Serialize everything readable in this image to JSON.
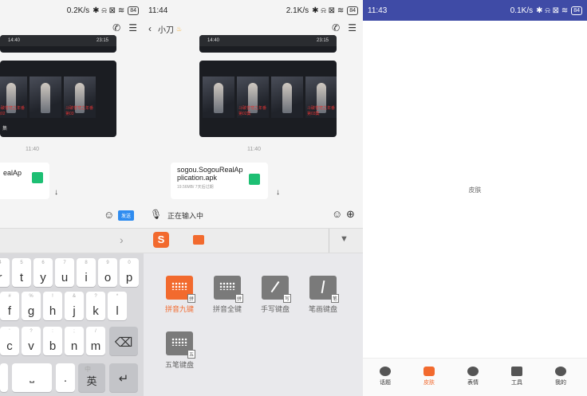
{
  "left_panel": {
    "status": {
      "speed": "0.2K/s",
      "battery": "84"
    },
    "video_times": [
      "14:40",
      "23:15"
    ],
    "tile_captions": [
      "斗破苍穹之年番 第02",
      "斗破苍穹之年番 第03",
      "集"
    ],
    "timestamp": "11:40",
    "file_name_partial": "ealAp",
    "send_label": "发送",
    "keyboard": {
      "row1": [
        {
          "sub": "5",
          "main": "t"
        },
        {
          "sub": "6",
          "main": "y"
        },
        {
          "sub": "7",
          "main": "u"
        },
        {
          "sub": "8",
          "main": "i"
        },
        {
          "sub": "9",
          "main": "o"
        },
        {
          "sub": "0",
          "main": "p"
        }
      ],
      "row2": [
        {
          "sub": "#",
          "main": "f"
        },
        {
          "sub": "%",
          "main": "g"
        },
        {
          "sub": "!",
          "main": "h"
        },
        {
          "sub": "&",
          "main": "j"
        },
        {
          "sub": "?",
          "main": "k"
        },
        {
          "sub": "*",
          "main": "l"
        }
      ],
      "row3": [
        {
          "sub": "'",
          "main": "c"
        },
        {
          "sub": "?",
          "main": "v"
        },
        {
          "sub": ":",
          "main": "b"
        },
        {
          "sub": ";",
          "main": "n"
        },
        {
          "sub": "/",
          "main": "m"
        }
      ],
      "lang_sub": "中",
      "lang_main": "英",
      "period": "."
    }
  },
  "middle_panel": {
    "status": {
      "time": "11:44",
      "speed": "2.1K/s",
      "battery": "84"
    },
    "contact_name": "小刀",
    "video_times": [
      "14:40",
      "23:15"
    ],
    "tile_captions": [
      "斗破苍穹之年番 第02集",
      "斗破苍穹之年番 第03集"
    ],
    "timestamp": "11:40",
    "file": {
      "name_line1": "sogou.SogouRealAp",
      "name_line2": "plication.apk",
      "meta": "19.56MB/ 7天后过期"
    },
    "input_text": "正在输入中",
    "keyboard_options": [
      {
        "label": "拼音九键",
        "badge": "拼",
        "active": true
      },
      {
        "label": "拼音全键",
        "badge": "拼",
        "active": false
      },
      {
        "label": "手写键盘",
        "badge": "写",
        "active": false
      },
      {
        "label": "笔画键盘",
        "badge": "笔",
        "active": false
      },
      {
        "label": "五笔键盘",
        "badge": "五",
        "active": false
      }
    ]
  },
  "right_panel": {
    "status": {
      "time": "11:43",
      "speed": "0.1K/s",
      "battery": "84"
    },
    "center_text": "皮肤",
    "nav": [
      "话题",
      "皮肤",
      "表情",
      "工具",
      "我的"
    ],
    "accent": "#f26a2e",
    "statusbar_color": "#3f4ba6"
  }
}
